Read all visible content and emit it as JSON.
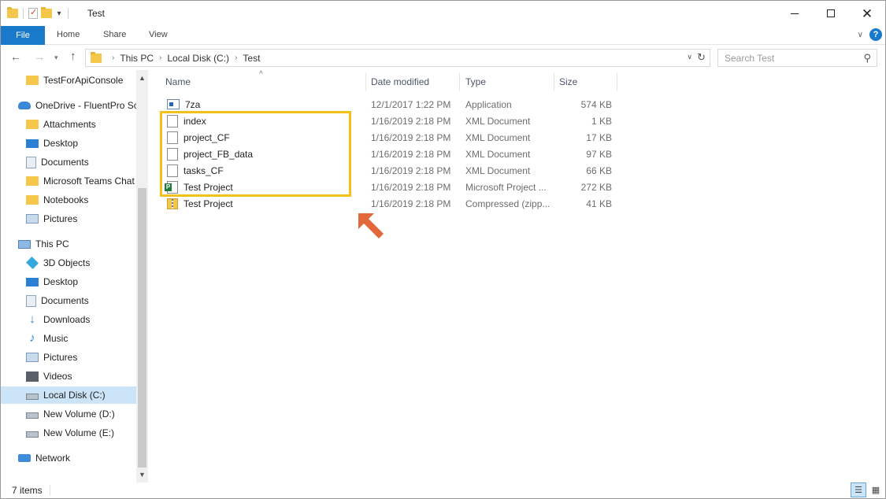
{
  "window": {
    "title": "Test",
    "controls": {
      "minimize_icon": "minimize-icon",
      "maximize_icon": "maximize-icon",
      "close_icon": "close-icon"
    }
  },
  "ribbon": {
    "tabs": [
      "File",
      "Home",
      "Share",
      "View"
    ],
    "help_icon_text": "?"
  },
  "address": {
    "breadcrumb": [
      "This PC",
      "Local Disk (C:)",
      "Test"
    ],
    "search_placeholder": "Search Test"
  },
  "nav_pane": {
    "items": [
      {
        "label": "TestForApiConsole",
        "icon": "folder-icon"
      },
      {
        "label": "OneDrive - FluentPro Sc",
        "icon": "onedrive-icon"
      },
      {
        "label": "Attachments",
        "icon": "folder-icon"
      },
      {
        "label": "Desktop",
        "icon": "desktop-icon"
      },
      {
        "label": "Documents",
        "icon": "documents-icon"
      },
      {
        "label": "Microsoft Teams Chat",
        "icon": "folder-icon"
      },
      {
        "label": "Notebooks",
        "icon": "folder-icon"
      },
      {
        "label": "Pictures",
        "icon": "pictures-icon"
      },
      {
        "label": "This PC",
        "icon": "pc-icon"
      },
      {
        "label": "3D Objects",
        "icon": "3d-objects-icon"
      },
      {
        "label": "Desktop",
        "icon": "desktop-icon"
      },
      {
        "label": "Documents",
        "icon": "documents-icon"
      },
      {
        "label": "Downloads",
        "icon": "downloads-icon"
      },
      {
        "label": "Music",
        "icon": "music-icon"
      },
      {
        "label": "Pictures",
        "icon": "pictures-icon"
      },
      {
        "label": "Videos",
        "icon": "videos-icon"
      },
      {
        "label": "Local Disk (C:)",
        "icon": "disk-icon",
        "selected": true
      },
      {
        "label": "New Volume (D:)",
        "icon": "disk-icon"
      },
      {
        "label": "New Volume (E:)",
        "icon": "disk-icon"
      },
      {
        "label": "Network",
        "icon": "network-icon"
      }
    ]
  },
  "file_list": {
    "columns": [
      "Name",
      "Date modified",
      "Type",
      "Size"
    ],
    "rows": [
      {
        "name": "7za",
        "date": "12/1/2017 1:22 PM",
        "type": "Application",
        "size": "574 KB",
        "icon": "application-icon"
      },
      {
        "name": "index",
        "date": "1/16/2019 2:18 PM",
        "type": "XML Document",
        "size": "1 KB",
        "icon": "xml-file-icon"
      },
      {
        "name": "project_CF",
        "date": "1/16/2019 2:18 PM",
        "type": "XML Document",
        "size": "17 KB",
        "icon": "xml-file-icon"
      },
      {
        "name": "project_FB_data",
        "date": "1/16/2019 2:18 PM",
        "type": "XML Document",
        "size": "97 KB",
        "icon": "xml-file-icon"
      },
      {
        "name": "tasks_CF",
        "date": "1/16/2019 2:18 PM",
        "type": "XML Document",
        "size": "66 KB",
        "icon": "xml-file-icon"
      },
      {
        "name": "Test Project",
        "date": "1/16/2019 2:18 PM",
        "type": "Microsoft Project ...",
        "size": "272 KB",
        "icon": "project-file-icon"
      },
      {
        "name": "Test Project",
        "date": "1/16/2019 2:18 PM",
        "type": "Compressed (zipp...",
        "size": "41 KB",
        "icon": "zip-file-icon"
      }
    ]
  },
  "annotations": {
    "highlight_color": "#f2c11a",
    "arrow_color": "#e0693a"
  },
  "status": {
    "item_count": "7 items"
  },
  "colors": {
    "accent": "#1979ca",
    "selection": "#cce4f7"
  }
}
